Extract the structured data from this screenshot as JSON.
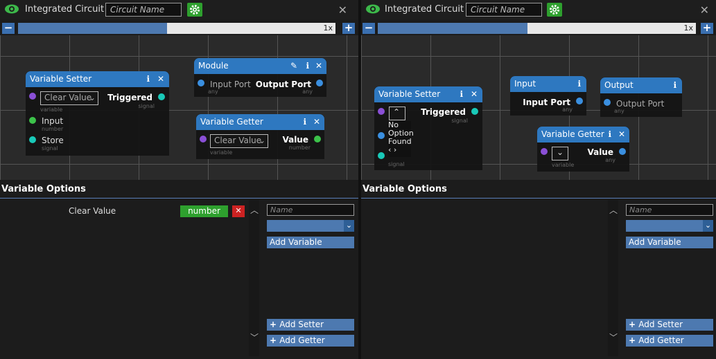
{
  "panels": [
    {
      "title": "Integrated Circuit",
      "circuit_name_placeholder": "Circuit Name",
      "zoom_label": "1x",
      "zoom_level": 0.47,
      "nodes": {
        "setter": {
          "title": "Variable Setter",
          "select": "Clear Value",
          "select_sub": "variable",
          "out": "Triggered",
          "out_sub": "signal",
          "in1": "Input",
          "in1_sub": "number",
          "in2": "Store",
          "in2_sub": "signal"
        },
        "module": {
          "title": "Module",
          "in": "Input Port",
          "in_sub": "any",
          "out": "Output Port",
          "out_sub": "any"
        },
        "getter": {
          "title": "Variable Getter",
          "select": "Clear Value",
          "select_sub": "variable",
          "out": "Value",
          "out_sub": "number"
        }
      },
      "options_title": "Variable Options",
      "variables": [
        {
          "name": "Clear Value",
          "type": "number"
        }
      ],
      "name_placeholder": "Name",
      "add_variable": "Add Variable",
      "add_setter": "Add Setter",
      "add_getter": "Add Getter"
    },
    {
      "title": "Integrated Circuit",
      "circuit_name_placeholder": "Circuit Name",
      "zoom_label": "1x",
      "zoom_level": 0.47,
      "nodes": {
        "setter": {
          "title": "Variable Setter",
          "no_option_1": "No",
          "no_option_2": "Option",
          "no_option_3": "Found",
          "out": "Triggered",
          "out_sub": "signal",
          "in2_sub": "signal"
        },
        "input": {
          "title": "Input",
          "out": "Input Port",
          "out_sub": "any"
        },
        "output": {
          "title": "Output",
          "in": "Output Port",
          "in_sub": "any"
        },
        "getter": {
          "title": "Variable Getter",
          "select_sub": "variable",
          "out": "Value",
          "out_sub": "any"
        }
      },
      "options_title": "Variable Options",
      "name_placeholder": "Name",
      "add_variable": "Add Variable",
      "add_setter": "Add Setter",
      "add_getter": "Add Getter"
    }
  ],
  "colors": {
    "accent": "#2e78c0",
    "green": "#2ea02e",
    "purple": "#8a4fd6",
    "cyan": "#19c9b8",
    "port_green": "#3cc24a",
    "port_blue": "#3a8fe0",
    "remove_red": "#cc2222"
  }
}
